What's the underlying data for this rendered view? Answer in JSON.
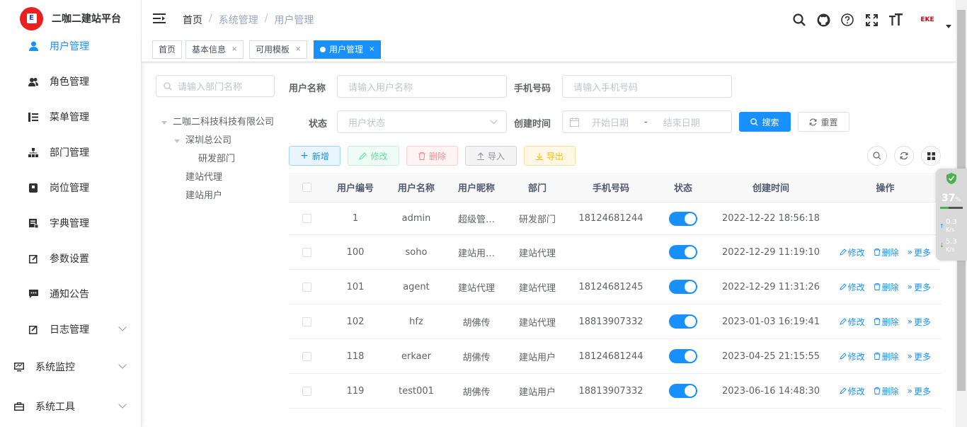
{
  "app": {
    "title": "二咖二建站平台",
    "logo_text": "E"
  },
  "sidebar": {
    "items": [
      {
        "label": "用户管理",
        "icon": "user-icon",
        "active": true
      },
      {
        "label": "角色管理",
        "icon": "peoples-icon"
      },
      {
        "label": "菜单管理",
        "icon": "tree-table-icon"
      },
      {
        "label": "部门管理",
        "icon": "tree-icon"
      },
      {
        "label": "岗位管理",
        "icon": "post-icon"
      },
      {
        "label": "字典管理",
        "icon": "dict-icon"
      },
      {
        "label": "参数设置",
        "icon": "edit-icon"
      },
      {
        "label": "通知公告",
        "icon": "message-icon"
      },
      {
        "label": "日志管理",
        "icon": "log-icon"
      }
    ],
    "groups": [
      {
        "label": "系统监控",
        "icon": "monitor-icon"
      },
      {
        "label": "系统工具",
        "icon": "tool-icon"
      }
    ]
  },
  "navbar": {
    "breadcrumb": [
      "首页",
      "系统管理",
      "用户管理"
    ],
    "avatar_logo": "EKE"
  },
  "tags": [
    {
      "label": "首页"
    },
    {
      "label": "基本信息",
      "close": "×"
    },
    {
      "label": "可用模板",
      "close": "×"
    },
    {
      "label": "用户管理",
      "close": "×",
      "active": true
    }
  ],
  "dept": {
    "search_placeholder": "请输入部门名称",
    "tree": {
      "root": "二咖二科技科技有限公司",
      "child": "深圳总公司",
      "grandchild": "研发部门",
      "other1": "建站代理",
      "other2": "建站用户"
    }
  },
  "form": {
    "username_label": "用户名称",
    "username_placeholder": "请输入用户名称",
    "phone_label": "手机号码",
    "phone_placeholder": "请输入手机号码",
    "status_label": "状态",
    "status_placeholder": "用户状态",
    "created_label": "创建时间",
    "start_placeholder": "开始日期",
    "range_sep": "-",
    "end_placeholder": "结束日期",
    "search_btn": "搜索",
    "reset_btn": "重置"
  },
  "toolbar": {
    "add": "新增",
    "edit": "修改",
    "delete": "删除",
    "import": "导入",
    "export": "导出"
  },
  "table": {
    "headers": [
      "用户编号",
      "用户名称",
      "用户昵称",
      "部门",
      "手机号码",
      "状态",
      "创建时间",
      "操作"
    ],
    "rows": [
      {
        "id": "1",
        "name": "admin",
        "nick": "超级管…",
        "dept": "研发部门",
        "phone": "18124681244",
        "status": true,
        "created": "2022-12-22 18:56:18",
        "ops": false
      },
      {
        "id": "100",
        "name": "soho",
        "nick": "建站用…",
        "dept": "建站代理",
        "phone": "",
        "status": true,
        "created": "2022-12-29 11:19:10",
        "ops": true
      },
      {
        "id": "101",
        "name": "agent",
        "nick": "建站代理",
        "dept": "建站代理",
        "phone": "18124681245",
        "status": true,
        "created": "2022-12-29 11:31:26",
        "ops": true
      },
      {
        "id": "102",
        "name": "hfz",
        "nick": "胡佛传",
        "dept": "建站代理",
        "phone": "18813907332",
        "status": true,
        "created": "2023-01-03 16:19:41",
        "ops": true
      },
      {
        "id": "118",
        "name": "erkaer",
        "nick": "胡佛传",
        "dept": "建站用户",
        "phone": "18124681244",
        "status": true,
        "created": "2023-04-25 21:15:55",
        "ops": true
      },
      {
        "id": "119",
        "name": "test001",
        "nick": "胡佛传",
        "dept": "建站用户",
        "phone": "18813907332",
        "status": true,
        "created": "2023-06-16 14:48:30",
        "ops": true
      }
    ],
    "op_labels": {
      "edit": "修改",
      "delete": "删除",
      "more": "更多"
    }
  },
  "speed_widget": {
    "percent": "37",
    "percent_unit": "%",
    "up": "0.3",
    "down": "5.3",
    "unit": "K/s"
  },
  "colors": {
    "primary": "#1890ff",
    "success": "#13ce66",
    "danger": "#ff4949",
    "warning": "#ffba00",
    "logo_red": "#e8201f"
  }
}
